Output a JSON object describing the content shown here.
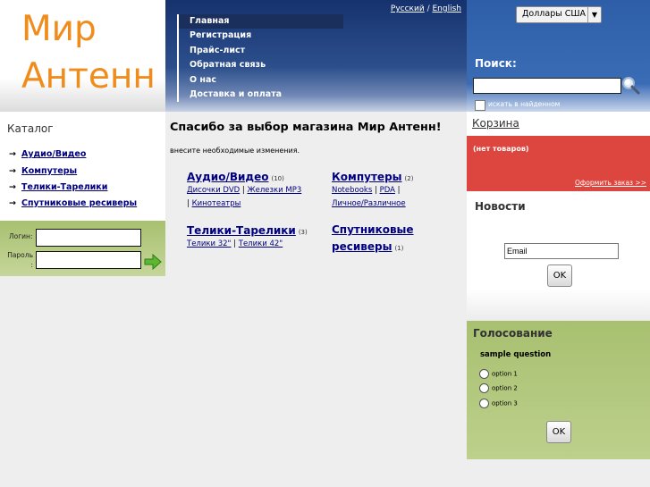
{
  "logo": {
    "line1": "Мир",
    "line2": "Антенн"
  },
  "nav": {
    "lang": {
      "ru": "Русский",
      "sep": "/",
      "en": "English"
    },
    "items": [
      "Главная",
      "Регистрация",
      "Прайс-лист",
      "Обратная связь",
      "О нас",
      "Доставка и оплата"
    ],
    "active_index": 0
  },
  "currency": {
    "selected": "Доллары США"
  },
  "search": {
    "title": "Поиск:",
    "value": "",
    "in_found_label": "искать в найденном"
  },
  "catalog": {
    "title": "Каталог",
    "items": [
      "Аудио/Видео",
      "Компутеры",
      "Телики-Тарелики",
      "Спутниковые ресиверы"
    ]
  },
  "login": {
    "login_label": "Логин:",
    "password_label": "Пароль :"
  },
  "main": {
    "heading": "Спасибо за выбор магазина Мир Антенн!",
    "note": "внесите необходимые изменения.",
    "categories": [
      {
        "title": "Аудио/Видео",
        "count": "(10)",
        "subs": [
          "Дисочки DVD",
          "Железки MP3",
          "Кинотеатры"
        ]
      },
      {
        "title": "Компутеры",
        "count": "(2)",
        "subs": [
          "Notebooks",
          "PDA",
          "Личное/Различное"
        ]
      },
      {
        "title": "Телики-Тарелики",
        "count": "(3)",
        "subs": [
          "Телики 32\"",
          "Телики 42\""
        ]
      },
      {
        "title": "Спутниковые ресиверы",
        "count": "(1)",
        "subs": []
      }
    ]
  },
  "cart": {
    "title": "Корзина",
    "empty": "(нет товаров)",
    "checkout": "Оформить заказ >>"
  },
  "news": {
    "title": "Новости",
    "email_value": "Email",
    "ok": "OK"
  },
  "poll": {
    "title": "Голосование",
    "question": "sample question",
    "options": [
      "option 1",
      "option 2",
      "option 3"
    ],
    "ok": "OK"
  },
  "colors": {
    "logo_orange": "#f08c1c",
    "nav_blue": "#2c4f8c",
    "cart_red": "#dc463e",
    "poll_green": "#a8c070",
    "link_blue": "#000080"
  }
}
